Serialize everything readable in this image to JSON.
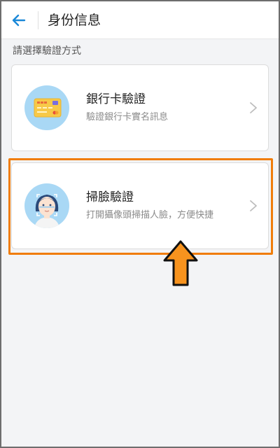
{
  "header": {
    "title": "身份信息",
    "back_icon": "back-arrow-icon"
  },
  "section_label": "請選擇驗證方式",
  "options": [
    {
      "title": "銀行卡驗證",
      "subtitle": "驗證銀行卡實名訊息",
      "icon": "bank-card-icon"
    },
    {
      "title": "掃臉驗證",
      "subtitle": "打開攝像頭掃描人臉，方便快捷",
      "icon": "face-scan-icon"
    }
  ],
  "colors": {
    "accent": "#1a88d8",
    "highlight": "#f07d0a",
    "arrow": "#f7931e",
    "background": "#f3f4f6"
  }
}
